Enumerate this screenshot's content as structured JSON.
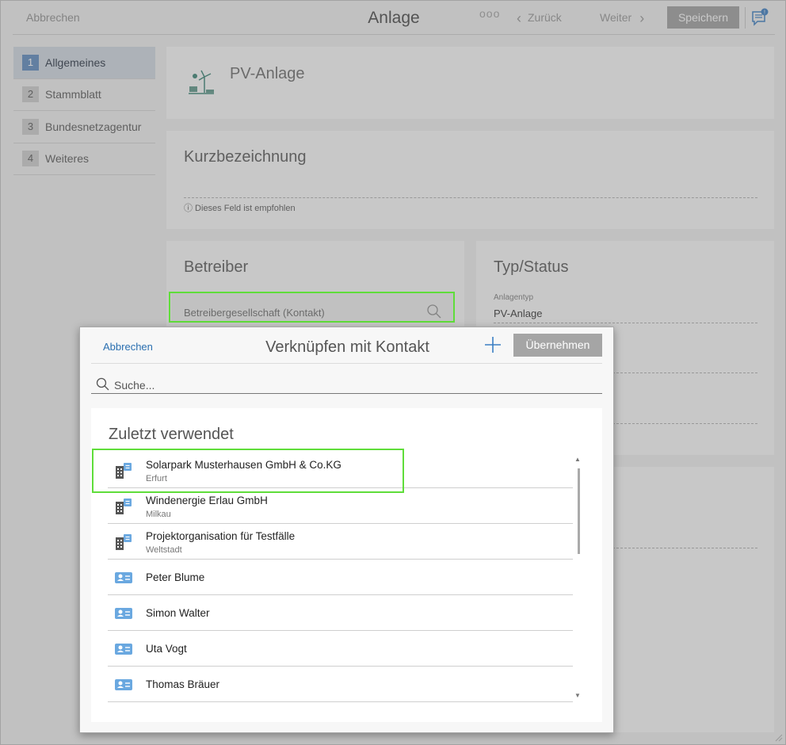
{
  "topbar": {
    "cancel": "Abbrechen",
    "title": "Anlage",
    "more": "ooo",
    "back": "Zurück",
    "forward": "Weiter",
    "save": "Speichern"
  },
  "nav": {
    "items": [
      {
        "num": "1",
        "label": "Allgemeines"
      },
      {
        "num": "2",
        "label": "Stammblatt"
      },
      {
        "num": "3",
        "label": "Bundesnetzagentur"
      },
      {
        "num": "4",
        "label": "Weiteres"
      }
    ]
  },
  "header_card": {
    "title": "PV-Anlage"
  },
  "short_name": {
    "heading": "Kurzbezeichnung",
    "hint": "ⓘ Dieses Feld ist empfohlen"
  },
  "operator": {
    "heading": "Betreiber",
    "company_placeholder": "Betreibergesellschaft (Kontakt)"
  },
  "type_status": {
    "heading": "Typ/Status",
    "type_label": "Anlagentyp",
    "type_value": "PV-Anlage"
  },
  "dialog": {
    "cancel": "Abbrechen",
    "title": "Verknüpfen mit Kontakt",
    "apply": "Übernehmen",
    "search_placeholder": "Suche...",
    "recent_title": "Zuletzt verwendet",
    "contacts": [
      {
        "name": "Solarpark Musterhausen GmbH & Co.KG",
        "sub": "Erfurt",
        "icon": "company-icon"
      },
      {
        "name": "Windenergie Erlau GmbH",
        "sub": "Milkau",
        "icon": "company-icon"
      },
      {
        "name": "Projektorganisation für Testfälle",
        "sub": "Weltstadt",
        "icon": "company-icon"
      },
      {
        "name": "Peter Blume",
        "sub": "",
        "icon": "person-card-icon"
      },
      {
        "name": "Simon Walter",
        "sub": "",
        "icon": "person-card-icon"
      },
      {
        "name": "Uta Vogt",
        "sub": "",
        "icon": "person-card-icon"
      },
      {
        "name": "Thomas Bräuer",
        "sub": "",
        "icon": "person-card-icon"
      }
    ]
  },
  "colors": {
    "accent_blue": "#2a6fb0",
    "highlight_green": "#5fdd3a",
    "nav_active": "#6a94c4"
  }
}
